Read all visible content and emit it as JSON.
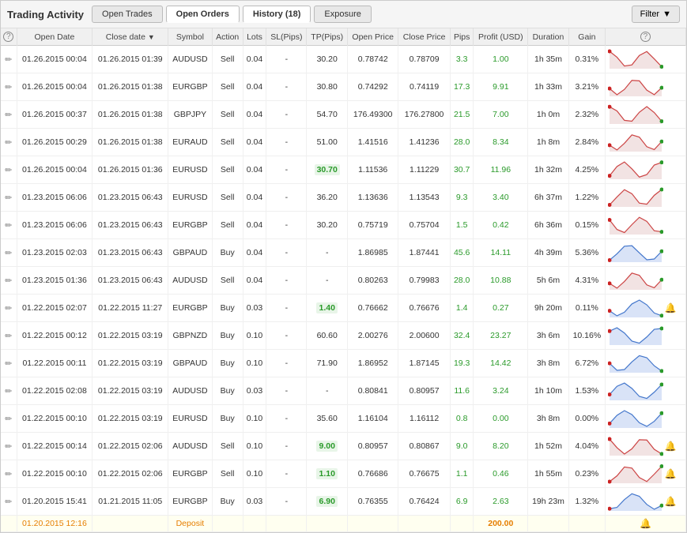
{
  "header": {
    "title": "Trading Activity",
    "tabs": [
      {
        "label": "Open Trades",
        "active": false
      },
      {
        "label": "Open Orders",
        "active": false
      },
      {
        "label": "History (18)",
        "active": true
      },
      {
        "label": "Exposure",
        "active": false
      }
    ],
    "filter_label": "Filter"
  },
  "table": {
    "columns": [
      "",
      "Open Date",
      "Close date",
      "Symbol",
      "Action",
      "Lots",
      "SL(Pips)",
      "TP(Pips)",
      "Open Price",
      "Close Price",
      "Pips",
      "Profit (USD)",
      "Duration",
      "Gain",
      ""
    ],
    "rows": [
      {
        "open": "01.26.2015 00:04",
        "close": "01.26.2015 01:39",
        "symbol": "AUDUSD",
        "action": "Sell",
        "lots": "0.04",
        "sl": "-",
        "tp": "30.20",
        "open_price": "0.78742",
        "close_price": "0.78709",
        "pips": "3.3",
        "profit": "1.00",
        "duration": "1h 35m",
        "gain": "0.31%",
        "pips_color": "green",
        "profit_color": "green",
        "tp_highlight": false
      },
      {
        "open": "01.26.2015 00:04",
        "close": "01.26.2015 01:38",
        "symbol": "EURGBP",
        "action": "Sell",
        "lots": "0.04",
        "sl": "-",
        "tp": "30.80",
        "open_price": "0.74292",
        "close_price": "0.74119",
        "pips": "17.3",
        "profit": "9.91",
        "duration": "1h 33m",
        "gain": "3.21%",
        "pips_color": "green",
        "profit_color": "green",
        "tp_highlight": false
      },
      {
        "open": "01.26.2015 00:37",
        "close": "01.26.2015 01:38",
        "symbol": "GBPJPY",
        "action": "Sell",
        "lots": "0.04",
        "sl": "-",
        "tp": "54.70",
        "open_price": "176.49300",
        "close_price": "176.27800",
        "pips": "21.5",
        "profit": "7.00",
        "duration": "1h 0m",
        "gain": "2.32%",
        "pips_color": "green",
        "profit_color": "green",
        "tp_highlight": false
      },
      {
        "open": "01.26.2015 00:29",
        "close": "01.26.2015 01:38",
        "symbol": "EURAUD",
        "action": "Sell",
        "lots": "0.04",
        "sl": "-",
        "tp": "51.00",
        "open_price": "1.41516",
        "close_price": "1.41236",
        "pips": "28.0",
        "profit": "8.34",
        "duration": "1h 8m",
        "gain": "2.84%",
        "pips_color": "green",
        "profit_color": "green",
        "tp_highlight": false
      },
      {
        "open": "01.26.2015 00:04",
        "close": "01.26.2015 01:36",
        "symbol": "EURUSD",
        "action": "Sell",
        "lots": "0.04",
        "sl": "-",
        "tp": "30.70",
        "open_price": "1.11536",
        "close_price": "1.11229",
        "pips": "30.7",
        "profit": "11.96",
        "duration": "1h 32m",
        "gain": "4.25%",
        "pips_color": "green",
        "profit_color": "green",
        "tp_highlight": true,
        "tp_color": "green"
      },
      {
        "open": "01.23.2015 06:06",
        "close": "01.23.2015 06:43",
        "symbol": "EURUSD",
        "action": "Sell",
        "lots": "0.04",
        "sl": "-",
        "tp": "36.20",
        "open_price": "1.13636",
        "close_price": "1.13543",
        "pips": "9.3",
        "profit": "3.40",
        "duration": "6h 37m",
        "gain": "1.22%",
        "pips_color": "green",
        "profit_color": "green",
        "tp_highlight": false
      },
      {
        "open": "01.23.2015 06:06",
        "close": "01.23.2015 06:43",
        "symbol": "EURGBP",
        "action": "Sell",
        "lots": "0.04",
        "sl": "-",
        "tp": "30.20",
        "open_price": "0.75719",
        "close_price": "0.75704",
        "pips": "1.5",
        "profit": "0.42",
        "duration": "6h 36m",
        "gain": "0.15%",
        "pips_color": "green",
        "profit_color": "green",
        "tp_highlight": false
      },
      {
        "open": "01.23.2015 02:03",
        "close": "01.23.2015 06:43",
        "symbol": "GBPAUD",
        "action": "Buy",
        "lots": "0.04",
        "sl": "-",
        "tp": "-",
        "open_price": "1.86985",
        "close_price": "1.87441",
        "pips": "45.6",
        "profit": "14.11",
        "duration": "4h 39m",
        "gain": "5.36%",
        "pips_color": "green",
        "profit_color": "green",
        "tp_highlight": false
      },
      {
        "open": "01.23.2015 01:36",
        "close": "01.23.2015 06:43",
        "symbol": "AUDUSD",
        "action": "Sell",
        "lots": "0.04",
        "sl": "-",
        "tp": "-",
        "open_price": "0.80263",
        "close_price": "0.79983",
        "pips": "28.0",
        "profit": "10.88",
        "duration": "5h 6m",
        "gain": "4.31%",
        "pips_color": "green",
        "profit_color": "green",
        "tp_highlight": false
      },
      {
        "open": "01.22.2015 02:07",
        "close": "01.22.2015 11:27",
        "symbol": "EURGBP",
        "action": "Buy",
        "lots": "0.03",
        "sl": "-",
        "tp": "1.40",
        "open_price": "0.76662",
        "close_price": "0.76676",
        "pips": "1.4",
        "profit": "0.27",
        "duration": "9h 20m",
        "gain": "0.11%",
        "pips_color": "green",
        "profit_color": "green",
        "tp_highlight": true,
        "tp_color": "green",
        "bell": true
      },
      {
        "open": "01.22.2015 00:12",
        "close": "01.22.2015 03:19",
        "symbol": "GBPNZD",
        "action": "Buy",
        "lots": "0.10",
        "sl": "-",
        "tp": "60.60",
        "open_price": "2.00276",
        "close_price": "2.00600",
        "pips": "32.4",
        "profit": "23.27",
        "duration": "3h 6m",
        "gain": "10.16%",
        "pips_color": "green",
        "profit_color": "green",
        "tp_highlight": false
      },
      {
        "open": "01.22.2015 00:11",
        "close": "01.22.2015 03:19",
        "symbol": "GBPAUD",
        "action": "Buy",
        "lots": "0.10",
        "sl": "-",
        "tp": "71.90",
        "open_price": "1.86952",
        "close_price": "1.87145",
        "pips": "19.3",
        "profit": "14.42",
        "duration": "3h 8m",
        "gain": "6.72%",
        "pips_color": "green",
        "profit_color": "green",
        "tp_highlight": false
      },
      {
        "open": "01.22.2015 02:08",
        "close": "01.22.2015 03:19",
        "symbol": "AUDUSD",
        "action": "Buy",
        "lots": "0.03",
        "sl": "-",
        "tp": "-",
        "open_price": "0.80841",
        "close_price": "0.80957",
        "pips": "11.6",
        "profit": "3.24",
        "duration": "1h 10m",
        "gain": "1.53%",
        "pips_color": "green",
        "profit_color": "green",
        "tp_highlight": false
      },
      {
        "open": "01.22.2015 00:10",
        "close": "01.22.2015 03:19",
        "symbol": "EURUSD",
        "action": "Buy",
        "lots": "0.10",
        "sl": "-",
        "tp": "35.60",
        "open_price": "1.16104",
        "close_price": "1.16112",
        "pips": "0.8",
        "profit": "0.00",
        "duration": "3h 8m",
        "gain": "0.00%",
        "pips_color": "green",
        "profit_color": "green",
        "tp_highlight": false
      },
      {
        "open": "01.22.2015 00:14",
        "close": "01.22.2015 02:06",
        "symbol": "AUDUSD",
        "action": "Sell",
        "lots": "0.10",
        "sl": "-",
        "tp": "9.00",
        "open_price": "0.80957",
        "close_price": "0.80867",
        "pips": "9.0",
        "profit": "8.20",
        "duration": "1h 52m",
        "gain": "4.04%",
        "pips_color": "green",
        "profit_color": "green",
        "tp_highlight": true,
        "tp_color": "green",
        "bell": true
      },
      {
        "open": "01.22.2015 00:10",
        "close": "01.22.2015 02:06",
        "symbol": "EURGBP",
        "action": "Sell",
        "lots": "0.10",
        "sl": "-",
        "tp": "1.10",
        "open_price": "0.76686",
        "close_price": "0.76675",
        "pips": "1.1",
        "profit": "0.46",
        "duration": "1h 55m",
        "gain": "0.23%",
        "pips_color": "green",
        "profit_color": "green",
        "tp_highlight": true,
        "tp_color": "green",
        "bell": true
      },
      {
        "open": "01.20.2015 15:41",
        "close": "01.21.2015 11:05",
        "symbol": "EURGBP",
        "action": "Buy",
        "lots": "0.03",
        "sl": "-",
        "tp": "6.90",
        "open_price": "0.76355",
        "close_price": "0.76424",
        "pips": "6.9",
        "profit": "2.63",
        "duration": "19h 23m",
        "gain": "1.32%",
        "pips_color": "green",
        "profit_color": "green",
        "tp_highlight": true,
        "tp_color": "green",
        "bell": true
      }
    ],
    "deposit_row": {
      "open": "01.20.2015 12:16",
      "label": "Deposit",
      "amount": "200.00",
      "bell": true
    }
  }
}
